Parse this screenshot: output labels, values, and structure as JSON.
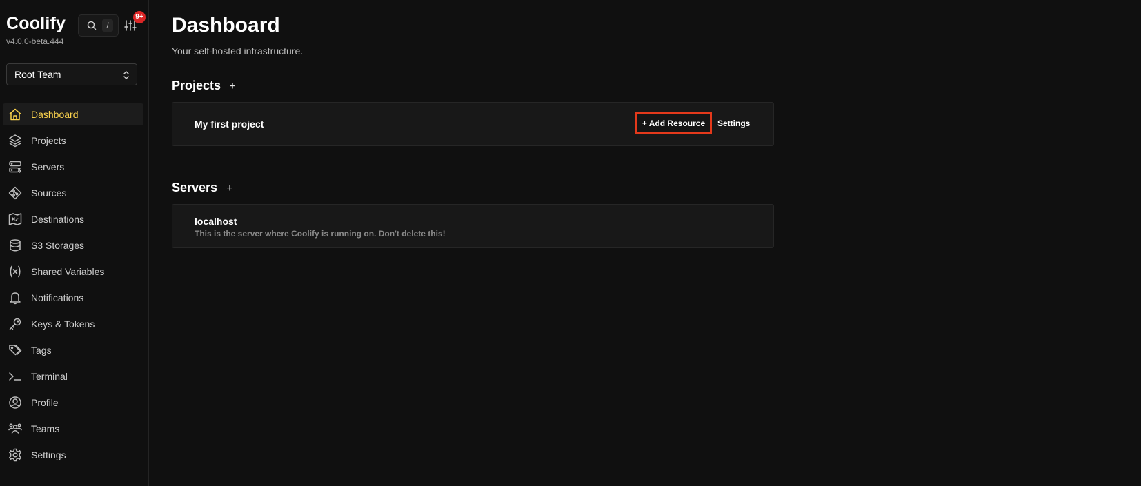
{
  "app": {
    "brand": "Coolify",
    "version": "v4.0.0-beta.444"
  },
  "search": {
    "shortcut": "/"
  },
  "notifications": {
    "badge": "9+"
  },
  "team": {
    "selected": "Root Team"
  },
  "sidebar": {
    "items": [
      {
        "label": "Dashboard",
        "icon": "home-icon",
        "active": true
      },
      {
        "label": "Projects",
        "icon": "layers-icon"
      },
      {
        "label": "Servers",
        "icon": "server-icon"
      },
      {
        "label": "Sources",
        "icon": "git-icon"
      },
      {
        "label": "Destinations",
        "icon": "map-icon"
      },
      {
        "label": "S3 Storages",
        "icon": "database-icon"
      },
      {
        "label": "Shared Variables",
        "icon": "variable-icon"
      },
      {
        "label": "Notifications",
        "icon": "bell-icon"
      },
      {
        "label": "Keys & Tokens",
        "icon": "key-icon"
      },
      {
        "label": "Tags",
        "icon": "tags-icon"
      },
      {
        "label": "Terminal",
        "icon": "terminal-icon"
      },
      {
        "label": "Profile",
        "icon": "user-circle-icon"
      },
      {
        "label": "Teams",
        "icon": "users-icon"
      },
      {
        "label": "Settings",
        "icon": "gear-icon"
      }
    ]
  },
  "main": {
    "title": "Dashboard",
    "subtitle": "Your self-hosted infrastructure.",
    "projects": {
      "heading": "Projects",
      "add": "+",
      "items": [
        {
          "name": "My first project",
          "add_resource": "+ Add Resource",
          "settings": "Settings"
        }
      ]
    },
    "servers": {
      "heading": "Servers",
      "add": "+",
      "items": [
        {
          "name": "localhost",
          "description": "This is the server where Coolify is running on. Don't delete this!"
        }
      ]
    }
  },
  "colors": {
    "accent": "#fcd34d",
    "highlight_border": "#e4391b",
    "badge": "#dc2626",
    "background": "#101010"
  }
}
